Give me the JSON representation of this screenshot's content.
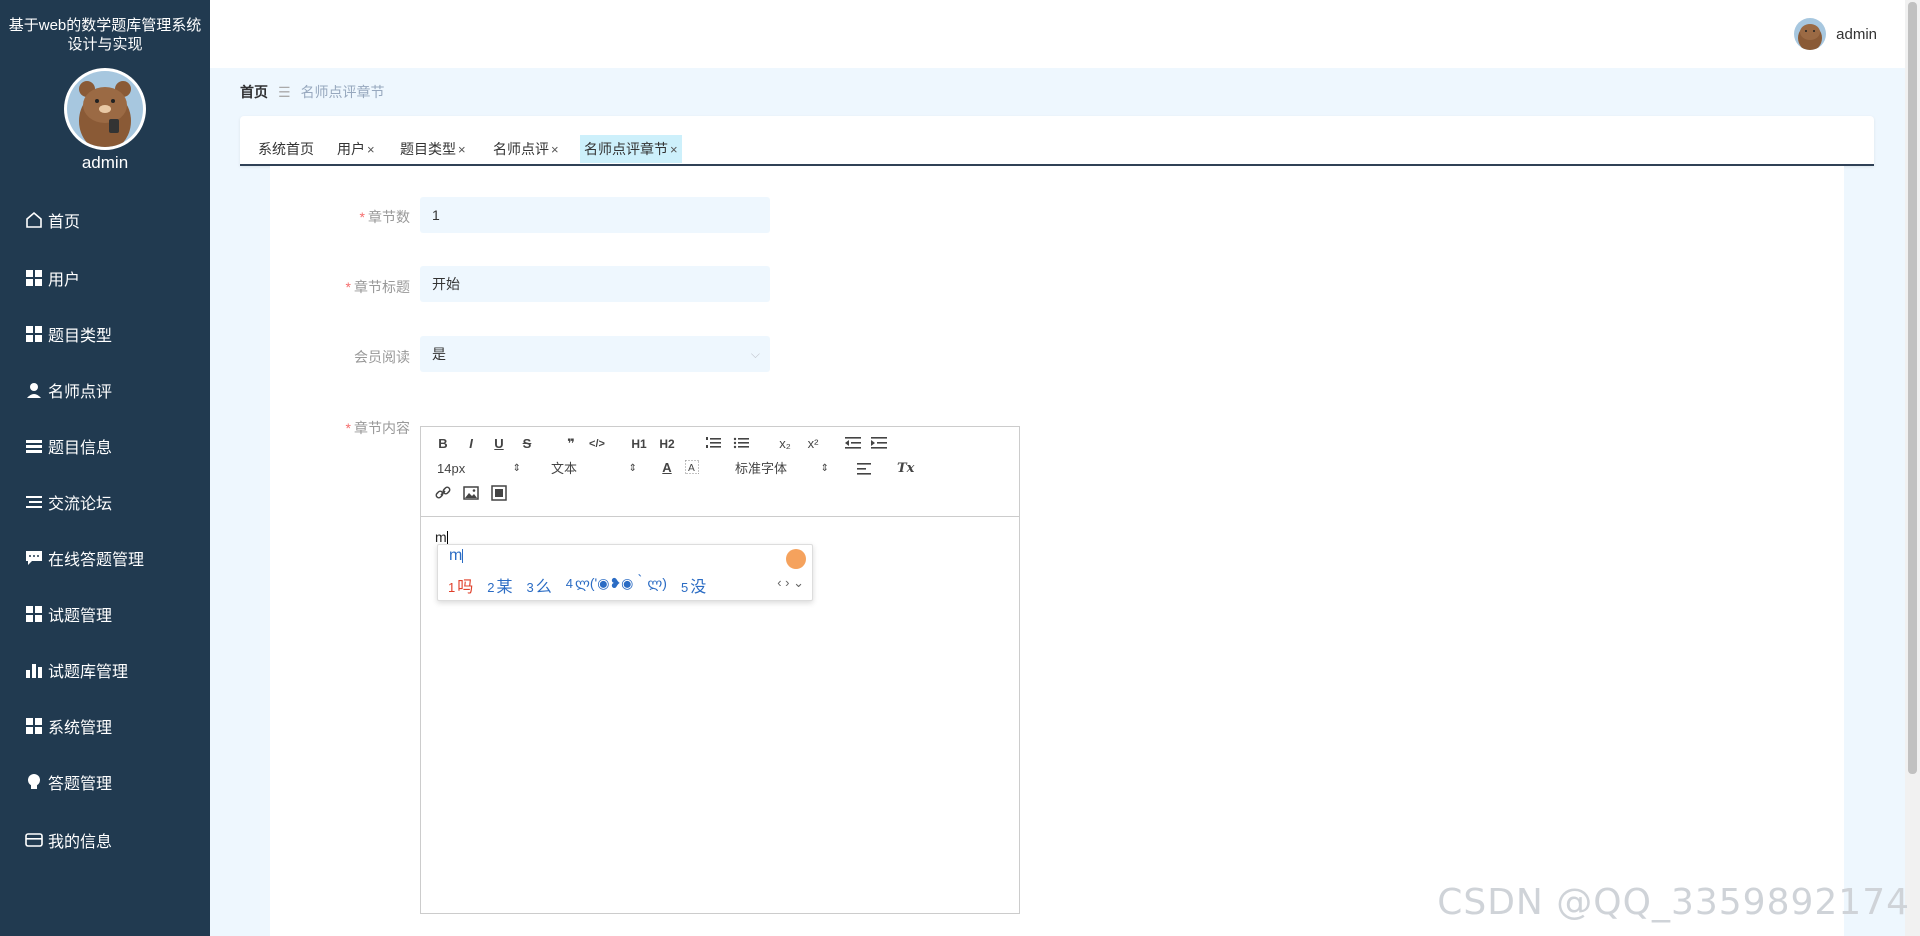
{
  "app": {
    "title": "基于web的数学题库管理系统设计与实现",
    "sidebar_user": "admin",
    "top_user": "admin"
  },
  "menu": [
    {
      "label": "首页",
      "icon": "home-icon"
    },
    {
      "label": "用户",
      "icon": "grid-icon"
    },
    {
      "label": "题目类型",
      "icon": "grid-icon"
    },
    {
      "label": "名师点评",
      "icon": "person-icon"
    },
    {
      "label": "题目信息",
      "icon": "list-icon"
    },
    {
      "label": "交流论坛",
      "icon": "list-icon"
    },
    {
      "label": "在线答题管理",
      "icon": "chat-icon"
    },
    {
      "label": "试题管理",
      "icon": "grid-icon"
    },
    {
      "label": "试题库管理",
      "icon": "bar-chart-icon"
    },
    {
      "label": "系统管理",
      "icon": "grid-icon"
    },
    {
      "label": "答题管理",
      "icon": "bulb-icon"
    },
    {
      "label": "我的信息",
      "icon": "card-icon"
    }
  ],
  "breadcrumb": {
    "home": "首页",
    "separator": "☰",
    "current": "名师点评章节"
  },
  "tabs": [
    {
      "label": "系统首页",
      "closable": false
    },
    {
      "label": "用户",
      "closable": true
    },
    {
      "label": "题目类型",
      "closable": true
    },
    {
      "label": "名师点评",
      "closable": true
    },
    {
      "label": "名师点评章节",
      "closable": true,
      "active": true
    }
  ],
  "tab_close": "×",
  "form": {
    "chapter_num": {
      "label": "章节数",
      "required": true,
      "value": "1"
    },
    "chapter_title": {
      "label": "章节标题",
      "required": true,
      "value": "开始"
    },
    "member_read": {
      "label": "会员阅读",
      "required": false,
      "value": "是"
    },
    "chapter_content": {
      "label": "章节内容",
      "required": true
    }
  },
  "editor": {
    "font_size": "14px",
    "header": "文本",
    "font_family": "标准字体",
    "content": "m",
    "buttons": [
      "B",
      "I",
      "U",
      "S",
      "❞",
      "</>",
      "H1",
      "H2",
      "ol",
      "ul",
      "x₂",
      "x²",
      "outdent",
      "indent",
      "A",
      "A-bg",
      "align",
      "Tx",
      "link",
      "image",
      "video"
    ]
  },
  "ime": {
    "composition": "m",
    "candidates": [
      {
        "num": "1",
        "text": "吗"
      },
      {
        "num": "2",
        "text": "某"
      },
      {
        "num": "3",
        "text": "么"
      },
      {
        "num": "4",
        "text": "ლ('◉❥◉｀ლ)"
      },
      {
        "num": "5",
        "text": "没"
      }
    ],
    "nav": "‹ › ⌄"
  },
  "watermark": "CSDN @QQ_3359892174"
}
